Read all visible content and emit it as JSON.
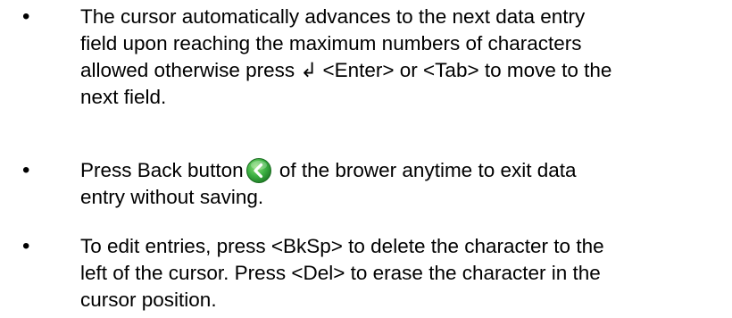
{
  "bullets": [
    {
      "lines": [
        "The cursor automatically advances to the next data entry",
        "field upon reaching the maximum numbers of characters",
        "allowed otherwise press ↲ <Enter> or <Tab> to move to the",
        "next field."
      ]
    },
    {
      "line1_before_icon": "Press Back button",
      "line1_after_icon": " of the brower anytime to exit data",
      "line2": "entry without saving.",
      "icon": "back-button-icon",
      "icon_color": "#3cb043"
    },
    {
      "lines": [
        "To edit entries, press <BkSp> to delete the character to the",
        "left of the cursor. Press <Del> to erase the character in the",
        "cursor position."
      ]
    }
  ],
  "bullet_symbol": "•"
}
